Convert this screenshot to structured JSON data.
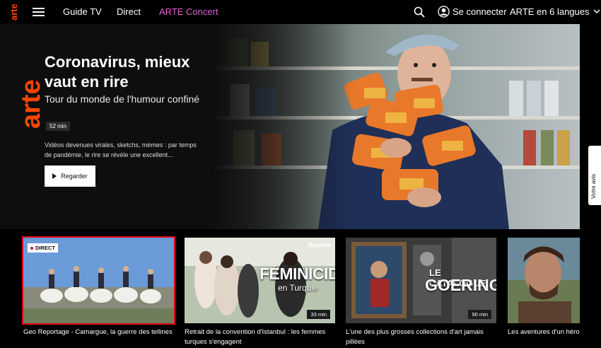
{
  "nav": {
    "logo_text": "arte",
    "links": [
      "Guide TV",
      "Direct",
      "ARTE Concert"
    ],
    "login": "Se connecter",
    "language": "ARTE en 6 langues"
  },
  "hero": {
    "title": "Coronavirus, mieux vaut en rire",
    "subtitle": "Tour du monde de l'humour confiné",
    "duration": "52 min",
    "description": "Vidéos devenues virales, sketchs, mèmes : par temps de pandémie, le rire se révèle une excellent...",
    "watch_label": "Regarder"
  },
  "side_tab": "Votre avis",
  "cards": [
    {
      "title": "Geo Reportage - Camargue, la guerre des tellines",
      "badge": "DIRECT",
      "duration": ""
    },
    {
      "title": "Retrait de la convention d'Istanbul : les femmes turques s'engagent",
      "badge": "Regards",
      "duration": "33 min",
      "overlay_main": "FÉMINICIDES",
      "overlay_sub": "en Turquie"
    },
    {
      "title": "L'une des plus grosses collections d'art jamais pillées",
      "duration": "90 min",
      "overlay_main": "LE CATALOGUE",
      "overlay_sub": "GOERING"
    },
    {
      "title": "Les aventures d'un héro",
      "duration": ""
    }
  ],
  "colors": {
    "accent": "#fd4600",
    "concert": "#e05fd0",
    "live_red": "#e2001a"
  }
}
